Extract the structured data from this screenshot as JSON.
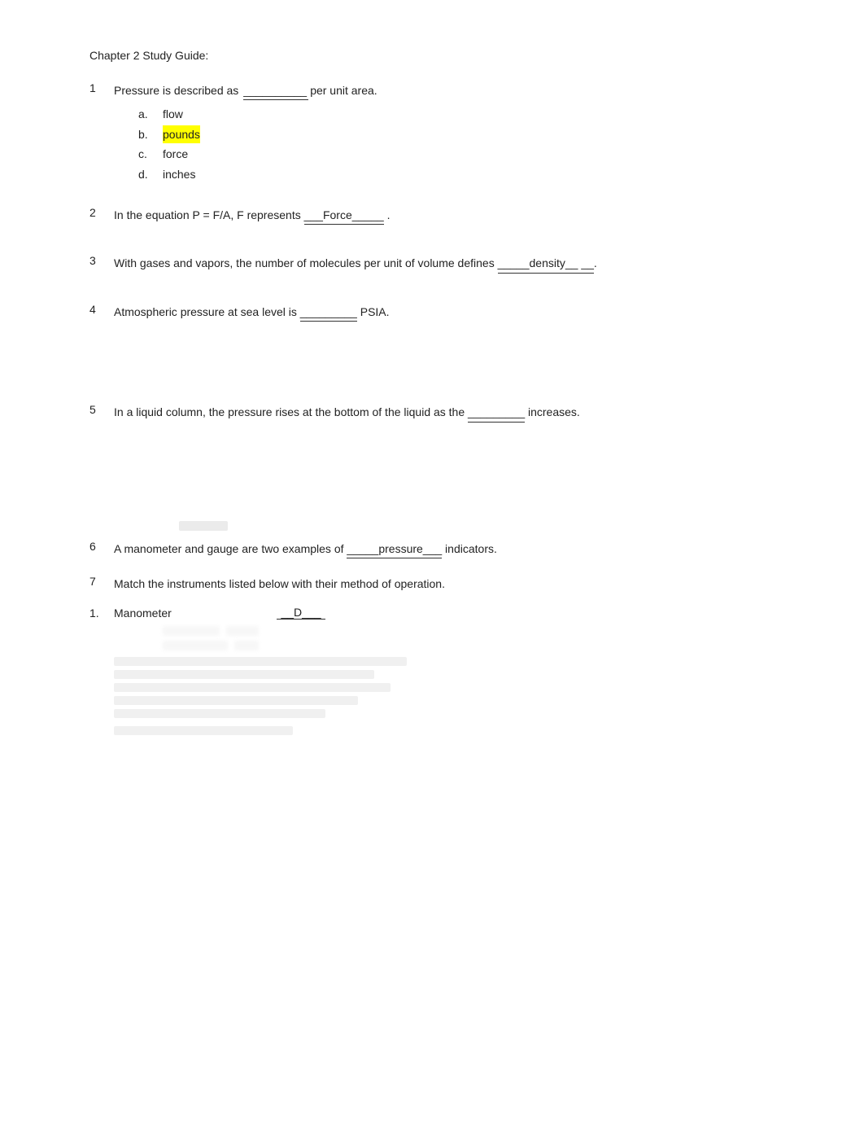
{
  "page": {
    "title": "Chapter 2 Study Guide:",
    "questions": [
      {
        "num": "1",
        "text_before": "Pressure is described as ",
        "blank": "__________ ",
        "text_after": "per unit area.",
        "has_answers": true,
        "answers": [
          {
            "label": "a.",
            "text": "flow",
            "highlight": false
          },
          {
            "label": "b.",
            "text": "pounds",
            "highlight": true
          },
          {
            "label": "c.",
            "text": "force",
            "highlight": false
          },
          {
            "label": "d.",
            "text": "inches",
            "highlight": false
          }
        ]
      },
      {
        "num": "2",
        "text_before": "In the equation P = F/A, F represents ",
        "blank": "___Force_____",
        "text_after": " .",
        "has_answers": false
      },
      {
        "num": "3",
        "text_before": "With gases and vapors, the number of molecules per unit of volume defines ",
        "blank": "_____density__ __",
        "text_after": ".",
        "has_answers": false
      },
      {
        "num": "4",
        "text_before": "Atmospheric pressure at sea level is ",
        "blank": "_________",
        "text_after": " PSIA.",
        "has_answers": false
      },
      {
        "num": "5",
        "text_before": "In a liquid column, the pressure rises at the bottom of the liquid as the ",
        "blank": "_________",
        "text_after": " increases.",
        "has_answers": false
      },
      {
        "num": "6",
        "text_before": "A manometer and gauge are two examples of ",
        "blank": "_____pressure___",
        "text_after": "   indicators.",
        "has_answers": false
      },
      {
        "num": "7",
        "text": "Match the instruments listed below with their method of operation.",
        "has_answers": false
      }
    ],
    "match_section": {
      "item1_num": "1.",
      "item1_name": "Manometer",
      "item1_answer": "__D___"
    }
  }
}
